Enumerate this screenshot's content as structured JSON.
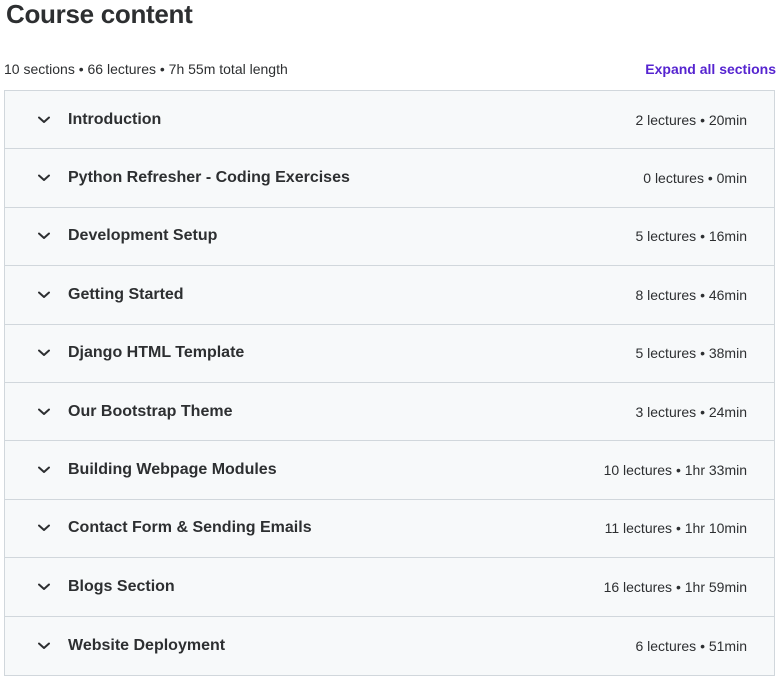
{
  "header": {
    "title": "Course content",
    "summary": "10 sections • 66 lectures • 7h 55m total length",
    "expand_label": "Expand all sections"
  },
  "icons": {
    "section_toggle": "chevron-down-icon"
  },
  "colors": {
    "link": "#5624d0",
    "section_bg": "#f7f9fa",
    "border": "#d1d7dc",
    "text": "#2d2f31"
  },
  "sections": [
    {
      "title": "Introduction",
      "meta": "2 lectures • 20min"
    },
    {
      "title": "Python Refresher - Coding Exercises",
      "meta": "0 lectures • 0min"
    },
    {
      "title": "Development Setup",
      "meta": "5 lectures • 16min"
    },
    {
      "title": "Getting Started",
      "meta": "8 lectures • 46min"
    },
    {
      "title": "Django HTML Template",
      "meta": "5 lectures • 38min"
    },
    {
      "title": "Our Bootstrap Theme",
      "meta": "3 lectures • 24min"
    },
    {
      "title": "Building Webpage Modules",
      "meta": "10 lectures • 1hr 33min"
    },
    {
      "title": "Contact Form & Sending Emails",
      "meta": "11 lectures • 1hr 10min"
    },
    {
      "title": "Blogs Section",
      "meta": "16 lectures • 1hr 59min"
    },
    {
      "title": "Website Deployment",
      "meta": "6 lectures • 51min"
    }
  ]
}
